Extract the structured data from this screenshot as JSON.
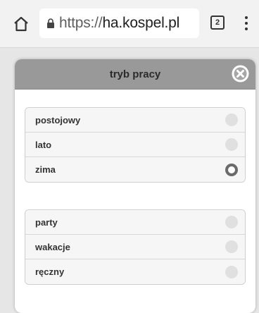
{
  "browser": {
    "url_scheme": "https://",
    "url_host": "ha.kospel.pl",
    "tab_count": "2"
  },
  "dialog": {
    "title": "tryb pracy",
    "groups": [
      {
        "options": [
          {
            "label": "postojowy",
            "selected": false
          },
          {
            "label": "lato",
            "selected": false
          },
          {
            "label": "zima",
            "selected": true
          }
        ]
      },
      {
        "options": [
          {
            "label": "party",
            "selected": false
          },
          {
            "label": "wakacje",
            "selected": false
          },
          {
            "label": "ręczny",
            "selected": false
          }
        ]
      }
    ]
  },
  "icons": {
    "home": "home-icon",
    "lock": "lock-icon",
    "tabs": "tab-switcher-icon",
    "menu": "more-vert-icon",
    "close": "close-circle-icon"
  }
}
